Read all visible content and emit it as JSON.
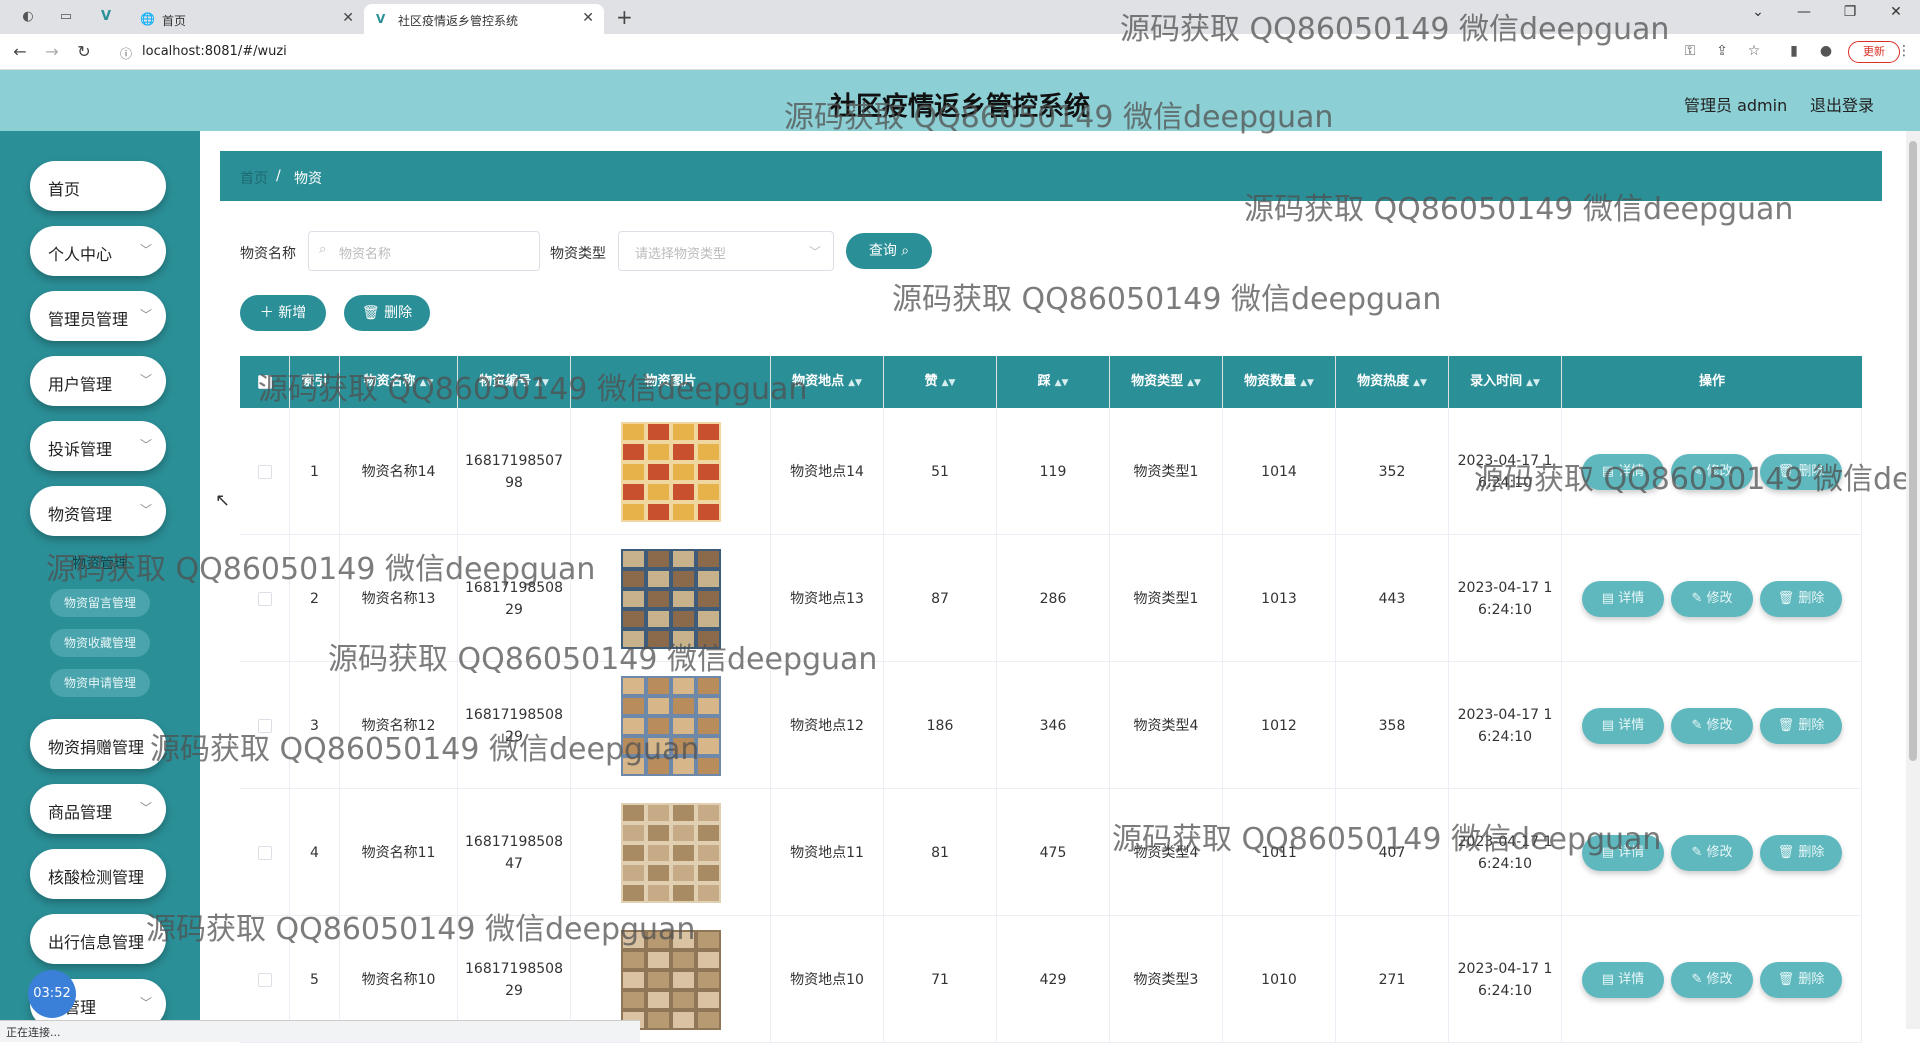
{
  "browser": {
    "tabs": [
      {
        "label": "首页"
      },
      {
        "label": "社区疫情返乡管控系统"
      }
    ],
    "url": "localhost:8081/#/wuzi",
    "update_label": "更新",
    "status_text": "正在连接..."
  },
  "header": {
    "title": "社区疫情返乡管控系统",
    "admin": "管理员 admin",
    "logout": "退出登录"
  },
  "sidebar": {
    "items": [
      {
        "label": "首页",
        "chevron": false
      },
      {
        "label": "个人中心",
        "chevron": true
      },
      {
        "label": "管理员管理",
        "chevron": true
      },
      {
        "label": "用户管理",
        "chevron": true
      },
      {
        "label": "投诉管理",
        "chevron": true
      },
      {
        "label": "物资管理",
        "chevron": true
      }
    ],
    "sub_items": [
      "物资管理",
      "物资留言管理",
      "物资收藏管理",
      "物资申请管理"
    ],
    "items_after": [
      {
        "label": "物资捐赠管理"
      },
      {
        "label": "商品管理"
      },
      {
        "label": "核酸检测管理"
      },
      {
        "label": "出行信息管理"
      },
      {
        "label": "…管理"
      }
    ],
    "clock": "03:52"
  },
  "breadcrumb": {
    "home": "首页",
    "sep": "/",
    "current": "物资"
  },
  "search": {
    "name_label": "物资名称",
    "name_placeholder": "物资名称",
    "type_label": "物资类型",
    "type_placeholder": "请选择物资类型",
    "query_button": "查询"
  },
  "actions": {
    "add": "新增",
    "delete": "删除"
  },
  "table": {
    "headers": [
      "",
      "索引",
      "物资名称",
      "物资编号",
      "物资图片",
      "物资地点",
      "赞",
      "踩",
      "物资类型",
      "物资数量",
      "物资热度",
      "录入时间",
      "操作"
    ],
    "rows": [
      {
        "index": "1",
        "name": "物资名称14",
        "code": "1681719850798",
        "place": "物资地点14",
        "up": "51",
        "down": "119",
        "type": "物资类型1",
        "qty": "1014",
        "heat": "352",
        "time": "2023-04-17 16:24:10"
      },
      {
        "index": "2",
        "name": "物资名称13",
        "code": "1681719850829",
        "place": "物资地点13",
        "up": "87",
        "down": "286",
        "type": "物资类型1",
        "qty": "1013",
        "heat": "443",
        "time": "2023-04-17 16:24:10"
      },
      {
        "index": "3",
        "name": "物资名称12",
        "code": "1681719850829",
        "place": "物资地点12",
        "up": "186",
        "down": "346",
        "type": "物资类型4",
        "qty": "1012",
        "heat": "358",
        "time": "2023-04-17 16:24:10"
      },
      {
        "index": "4",
        "name": "物资名称11",
        "code": "1681719850847",
        "place": "物资地点11",
        "up": "81",
        "down": "475",
        "type": "物资类型4",
        "qty": "1011",
        "heat": "407",
        "time": "2023-04-17 16:24:10"
      },
      {
        "index": "5",
        "name": "物资名称10",
        "code": "1681719850829",
        "place": "物资地点10",
        "up": "71",
        "down": "429",
        "type": "物资类型3",
        "qty": "1010",
        "heat": "271",
        "time": "2023-04-17 16:24:10"
      }
    ],
    "op_labels": {
      "detail": "详情",
      "edit": "修改",
      "delete": "删除"
    }
  },
  "watermark": "源码获取 QQ86050149 微信deepguan"
}
